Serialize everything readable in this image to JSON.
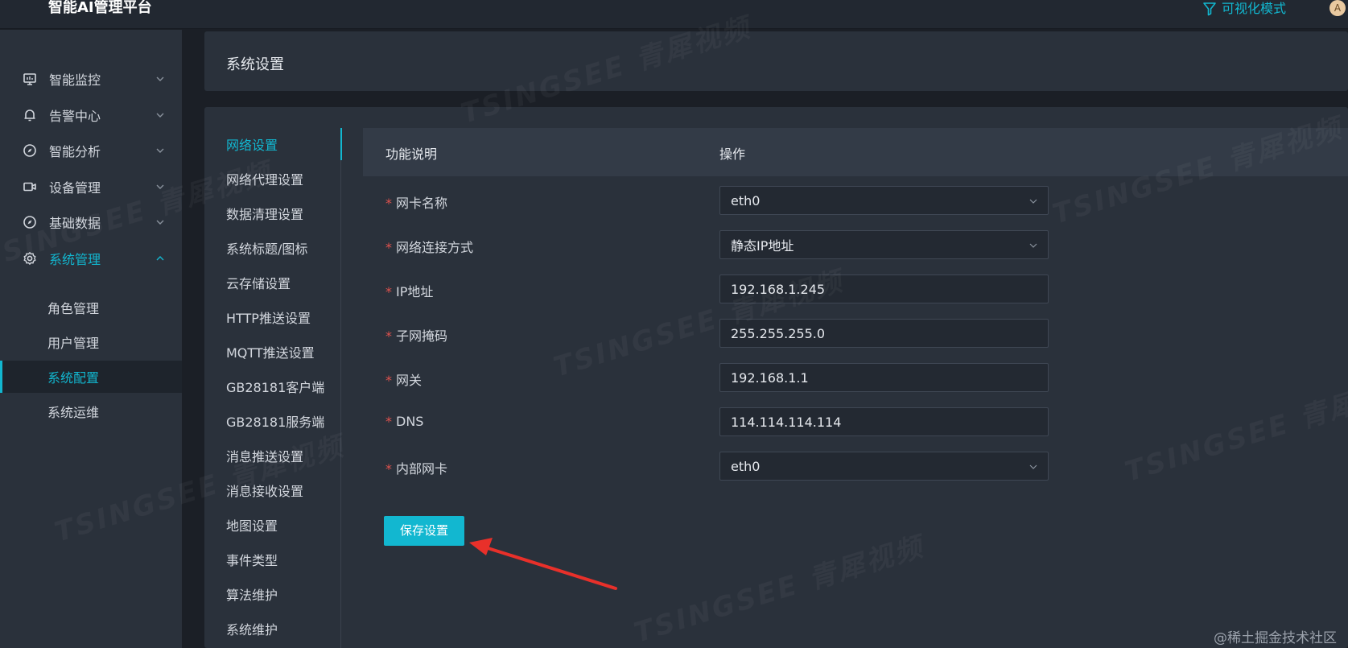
{
  "topbar": {
    "app_title": "智能AI管理平台",
    "visual_mode_label": "可视化模式",
    "avatar_letter": "A"
  },
  "sidebar": {
    "items": [
      {
        "label": "智能监控",
        "icon": "monitor-icon"
      },
      {
        "label": "告警中心",
        "icon": "bell-icon"
      },
      {
        "label": "智能分析",
        "icon": "compass-icon"
      },
      {
        "label": "设备管理",
        "icon": "camera-icon"
      },
      {
        "label": "基础数据",
        "icon": "compass-icon"
      },
      {
        "label": "系统管理",
        "icon": "gear-icon",
        "expanded": true
      }
    ],
    "sub_items": [
      {
        "label": "角色管理"
      },
      {
        "label": "用户管理"
      },
      {
        "label": "系统配置",
        "active": true
      },
      {
        "label": "系统运维"
      }
    ]
  },
  "header": {
    "title": "系统设置"
  },
  "settings_menu": {
    "items": [
      {
        "label": "网络设置",
        "active": true
      },
      {
        "label": "网络代理设置"
      },
      {
        "label": "数据清理设置"
      },
      {
        "label": "系统标题/图标"
      },
      {
        "label": "云存储设置"
      },
      {
        "label": "HTTP推送设置"
      },
      {
        "label": "MQTT推送设置"
      },
      {
        "label": "GB28181客户端"
      },
      {
        "label": "GB28181服务端"
      },
      {
        "label": "消息推送设置"
      },
      {
        "label": "消息接收设置"
      },
      {
        "label": "地图设置"
      },
      {
        "label": "事件类型"
      },
      {
        "label": "算法维护"
      },
      {
        "label": "系统维护"
      }
    ]
  },
  "table": {
    "col_function": "功能说明",
    "col_operation": "操作"
  },
  "form": {
    "required_mark": "*",
    "fields": [
      {
        "label": "网卡名称",
        "value": "eth0",
        "type": "select"
      },
      {
        "label": "网络连接方式",
        "value": "静态IP地址",
        "type": "select"
      },
      {
        "label": "IP地址",
        "value": "192.168.1.245",
        "type": "input"
      },
      {
        "label": "子网掩码",
        "value": "255.255.255.0",
        "type": "input"
      },
      {
        "label": "网关",
        "value": "192.168.1.1",
        "type": "input"
      },
      {
        "label": "DNS",
        "value": "114.114.114.114",
        "type": "input"
      },
      {
        "label": "内部网卡",
        "value": "eth0",
        "type": "select"
      }
    ],
    "save_label": "保存设置"
  },
  "watermark_text": "TSINGSEE 青犀视频",
  "corner_mark": "@稀土掘金技术社区",
  "colors": {
    "accent": "#12b7d0",
    "required": "#e0524e",
    "arrow": "#e8302a"
  }
}
